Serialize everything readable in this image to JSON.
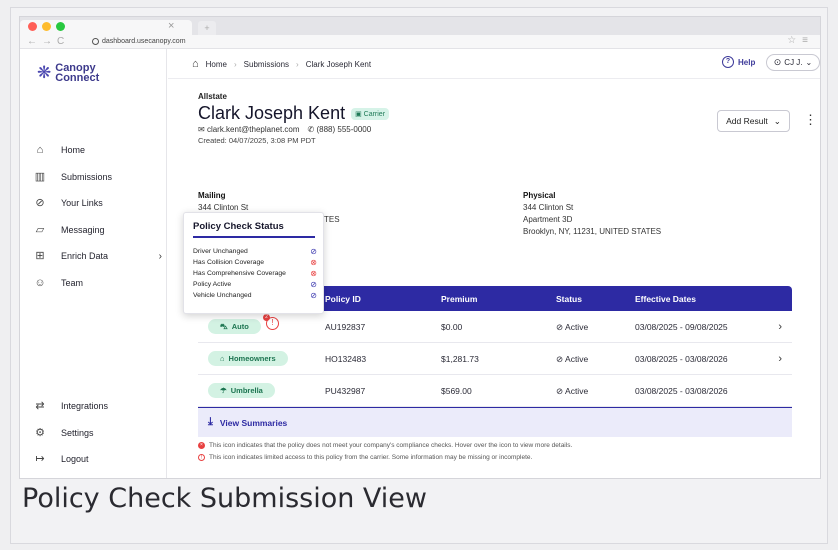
{
  "caption": "Policy Check Submission View",
  "browser": {
    "url": "dashboard.usecanopy.com",
    "dot_colors": [
      "#ff5f57",
      "#febc2e",
      "#28c840"
    ]
  },
  "logo": {
    "line1": "Canopy",
    "line2": "Connect",
    "icon": "canopy-logo-icon"
  },
  "sidebar": {
    "items": [
      {
        "label": "Home",
        "icon": "home-icon",
        "glyph": "⌂"
      },
      {
        "label": "Submissions",
        "icon": "submissions-icon",
        "glyph": "▥"
      },
      {
        "label": "Your Links",
        "icon": "link-icon",
        "glyph": "⊘"
      },
      {
        "label": "Messaging",
        "icon": "messaging-icon",
        "glyph": "▱"
      },
      {
        "label": "Enrich Data",
        "icon": "enrich-data-icon",
        "glyph": "⊞"
      },
      {
        "label": "Team",
        "icon": "team-icon",
        "glyph": "☺"
      }
    ],
    "bottom": [
      {
        "label": "Integrations",
        "icon": "integrations-icon",
        "glyph": "⇄"
      },
      {
        "label": "Settings",
        "icon": "settings-icon",
        "glyph": "⚙"
      },
      {
        "label": "Logout",
        "icon": "logout-icon",
        "glyph": "↦"
      }
    ]
  },
  "breadcrumb": [
    "Home",
    "Submissions",
    "Clark Joseph Kent"
  ],
  "header": {
    "help": "Help",
    "user": "CJ J."
  },
  "profile": {
    "carrier": "Allstate",
    "name": "Clark Joseph Kent",
    "badge": "Carrier",
    "email": "clark.kent@theplanet.com",
    "phone": "(888) 555-0000",
    "created": "Created: 04/07/2025, 3:08 PM PDT",
    "add_result": "Add Result"
  },
  "mailing": {
    "title": "Mailing",
    "line1": "344 Clinton St",
    "line3_tail": "TES"
  },
  "physical": {
    "title": "Physical",
    "line1": "344 Clinton St",
    "line2": "Apartment 3D",
    "line3": "Brooklyn, NY, 11231, UNITED STATES"
  },
  "table": {
    "headers": [
      "Policy ID",
      "Premium",
      "Status",
      "Effective Dates"
    ],
    "rows": [
      {
        "type": "Auto",
        "id": "AU192837",
        "premium": "$0.00",
        "status": "Active",
        "dates": "03/08/2025 - 09/08/2025",
        "warn_count": "2"
      },
      {
        "type": "Homeowners",
        "id": "HO132483",
        "premium": "$1,281.73",
        "status": "Active",
        "dates": "03/08/2025 - 03/08/2026"
      },
      {
        "type": "Umbrella",
        "id": "PU432987",
        "premium": "$569.00",
        "status": "Active",
        "dates": "03/08/2025 - 03/08/2026"
      }
    ],
    "view_summaries": "View Summaries"
  },
  "notes": [
    "This icon indicates that the policy does not meet your company's compliance checks. Hover over the icon to view more details.",
    "This icon indicates limited access to this policy from the carrier. Some information may be missing or incomplete."
  ],
  "popover": {
    "title": "Policy Check Status",
    "items": [
      {
        "label": "Driver Unchanged",
        "pass": true
      },
      {
        "label": "Has Collision Coverage",
        "pass": false
      },
      {
        "label": "Has Comprehensive Coverage",
        "pass": false
      },
      {
        "label": "Policy Active",
        "pass": true
      },
      {
        "label": "Vehicle Unchanged",
        "pass": true
      }
    ]
  },
  "colors": {
    "accent": "#2d2aa3",
    "pill": "#d3f2e3",
    "error": "#e84141"
  }
}
